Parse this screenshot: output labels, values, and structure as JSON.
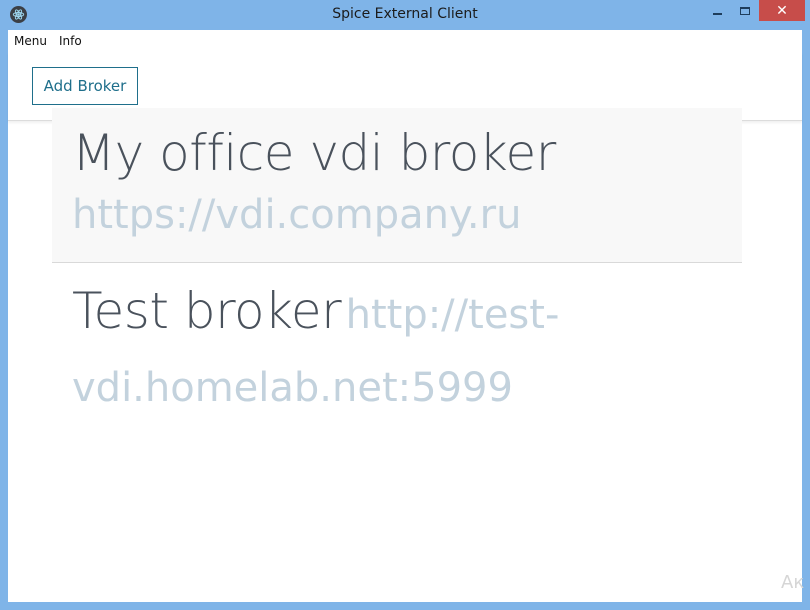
{
  "window": {
    "title": "Spice External Client",
    "close_glyph": "✕"
  },
  "menubar": {
    "items": [
      "Menu",
      "Info"
    ]
  },
  "toolbar": {
    "add_broker_label": "Add Broker"
  },
  "brokers": [
    {
      "name": "My office vdi broker",
      "url": "https://vdi.company.ru"
    },
    {
      "name": "Test broker",
      "url_part1": "http://test-",
      "url_part2": "vdi.homelab.net:5999"
    }
  ],
  "watermark": "Ак",
  "colors": {
    "frame": "#7fb4e8",
    "close_button": "#c74d4a",
    "accent": "#1f6f8b",
    "broker_name": "#4a525c",
    "broker_url": "#c3d2dd"
  }
}
